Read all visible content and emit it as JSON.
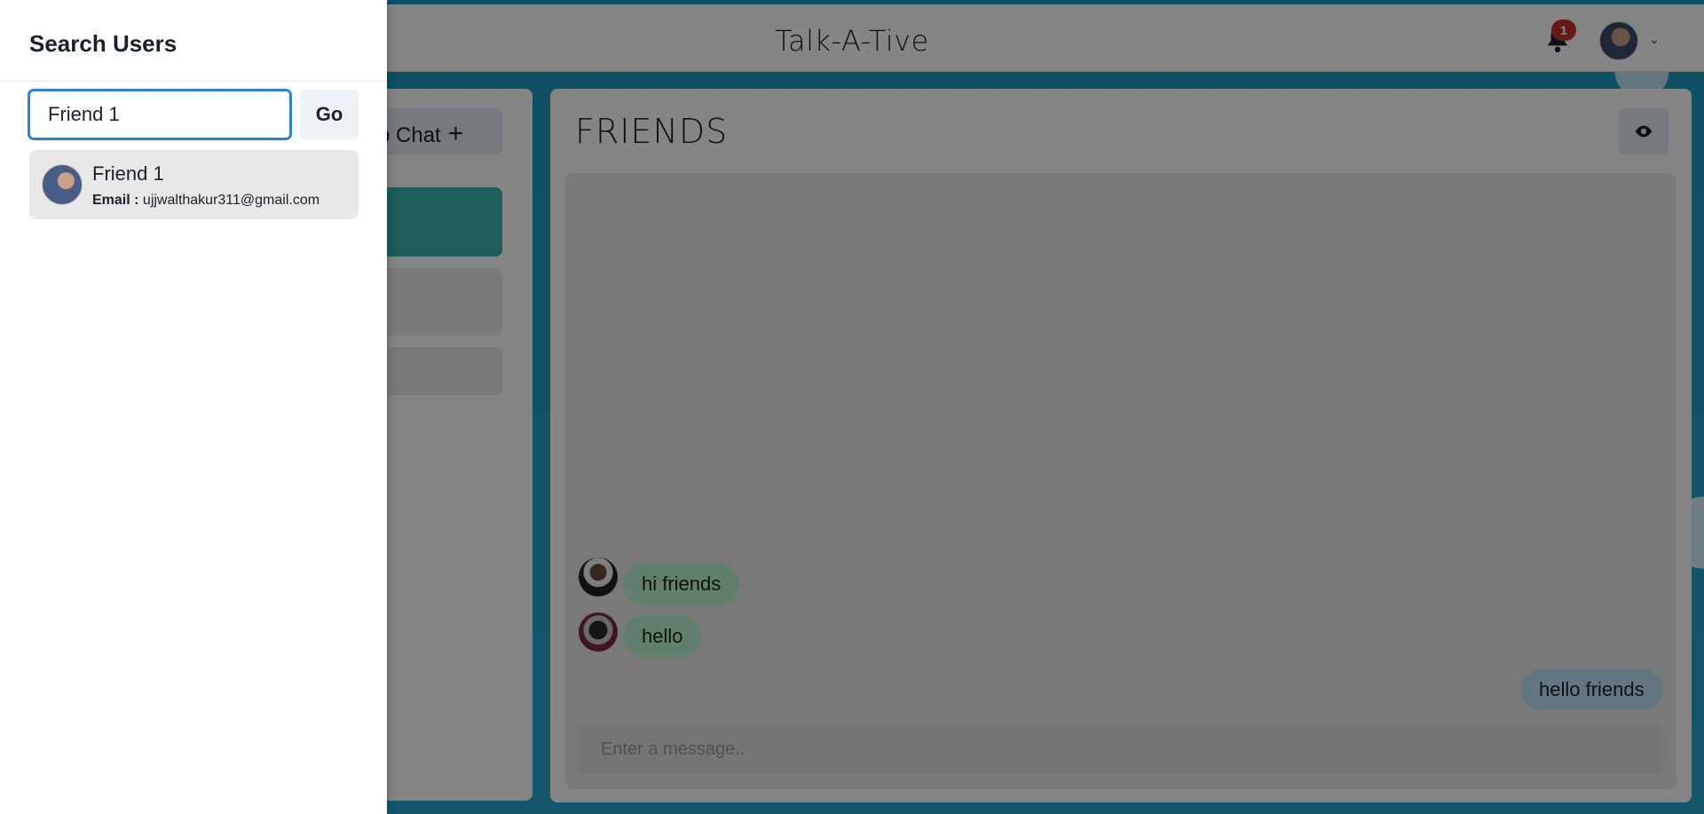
{
  "app": {
    "brand": "Talk-A-Tive",
    "notification_count": "1"
  },
  "sidebar": {
    "group_chat_label": "p Chat"
  },
  "chat": {
    "title": "FRIENDS",
    "messages": [
      {
        "text": "hi friends",
        "side": "left"
      },
      {
        "text": "hello",
        "side": "left"
      },
      {
        "text": "hello friends",
        "side": "right"
      }
    ],
    "input_placeholder": "Enter a message.."
  },
  "drawer": {
    "title": "Search Users",
    "search_value": "Friend 1",
    "go_label": "Go",
    "results": [
      {
        "name": "Friend 1",
        "email_label": "Email :",
        "email": "ujjwalthakur311@gmail.com"
      }
    ]
  },
  "colors": {
    "accent": "#3182ce",
    "active_chat": "#38b2ac",
    "badge": "#c53030",
    "incoming_bubble": "#b9f5d0",
    "outgoing_bubble": "#bee3f8"
  }
}
